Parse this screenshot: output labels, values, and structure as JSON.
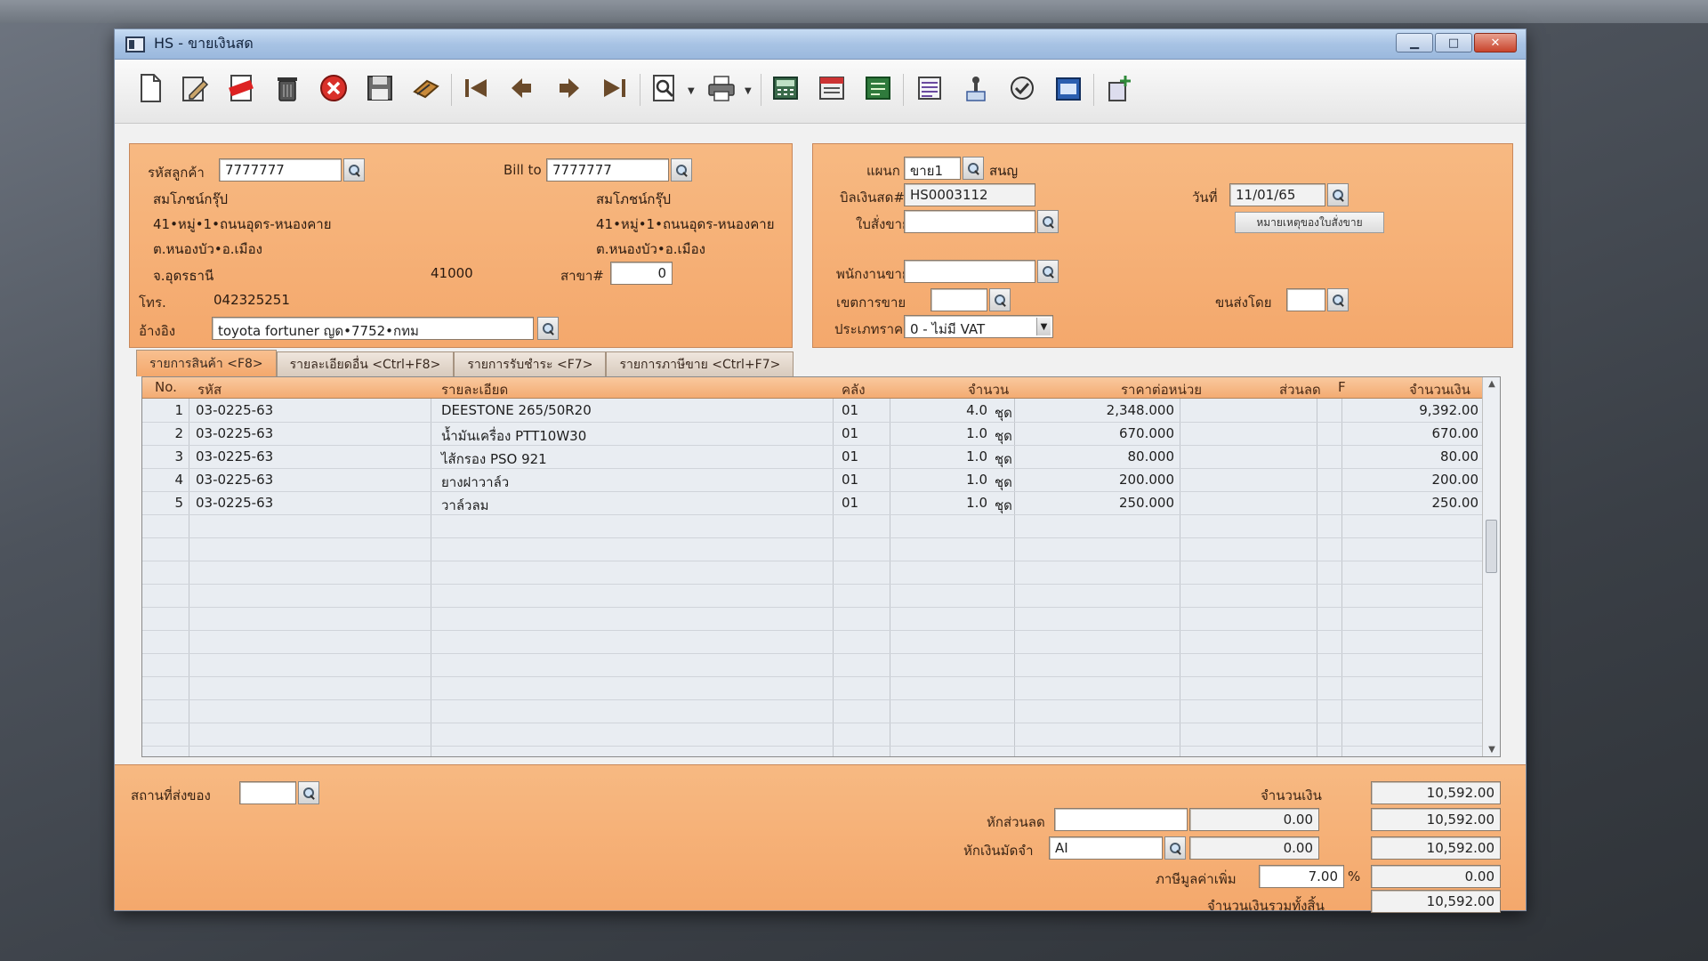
{
  "window": {
    "title": "HS - ขายเงินสด"
  },
  "titlebar_controls": {
    "minimize": "▁",
    "maximize": "□",
    "close": "✕"
  },
  "toolbar": [
    "new-icon",
    "edit-icon",
    "void-icon",
    "delete-icon",
    "cancel-icon",
    "save-icon",
    "attach-icon",
    "first-record-icon",
    "previous-record-icon",
    "next-record-icon",
    "last-record-icon",
    "preview-icon",
    "print-icon",
    "calculator-icon",
    "register-icon",
    "price-icon",
    "report-icon",
    "approve-icon",
    "confirm-icon",
    "ok-icon",
    "transfer-icon"
  ],
  "customer": {
    "code_label": "รหัสลูกค้า",
    "code": "7777777",
    "bill_to_label": "Bill to",
    "bill_to": "7777777",
    "name": "สมโภชน์กรุ๊ป",
    "address1": "41•หมู่•1•ถนนอุดร-หนองคาย",
    "address2": "ต.หนองบัว•อ.เมือง",
    "province": "จ.อุดรธานี",
    "postcode": "41000",
    "bill_name": "สมโภชน์กรุ๊ป",
    "bill_address1": "41•หมู่•1•ถนนอุดร-หนองคาย",
    "bill_address2": "ต.หนองบัว•อ.เมือง",
    "branch_label": "สาขา#",
    "branch": "0",
    "phone_label": "โทร.",
    "phone": "042325251",
    "reference_label": "อ้างอิง",
    "reference": "toyota fortuner ญด•7752•กทม"
  },
  "document": {
    "dept_label": "แผนก",
    "dept": "ขาย1",
    "dept_name": "สนญ",
    "bill_no_label": "บิลเงินสด#",
    "bill_no": "HS0003112",
    "date_label": "วันที่",
    "date": "11/01/65",
    "so_label": "ใบสั่งขาย",
    "so": "",
    "so_note_button": "หมายเหตุของใบสั่งขาย",
    "salesman_label": "พนักงานขาย",
    "salesman": "",
    "area_label": "เขตการขาย",
    "area": "",
    "ship_by_label": "ขนส่งโดย",
    "ship_by": "",
    "price_type_label": "ประเภทราคา",
    "price_type": "0 - ไม่มี VAT"
  },
  "tabs": [
    {
      "label": "รายการสินค้า <F8>",
      "active": true
    },
    {
      "label": "รายละเอียดอื่น <Ctrl+F8>",
      "active": false
    },
    {
      "label": "รายการรับชำระ <F7>",
      "active": false
    },
    {
      "label": "รายการภาษีขาย <Ctrl+F7>",
      "active": false
    }
  ],
  "grid": {
    "headers": {
      "no": "No.",
      "code": "รหัส",
      "desc": "รายละเอียด",
      "wh": "คลัง",
      "qty": "จำนวน",
      "price": "ราคาต่อหน่วย",
      "discount": "ส่วนลด",
      "f": "F",
      "amount": "จำนวนเงิน"
    },
    "rows": [
      {
        "no": "1",
        "code": "03-0225-63",
        "desc": "DEESTONE 265/50R20",
        "wh": "01",
        "qty": "4.0",
        "unit": "ชุด",
        "price": "2,348.000",
        "discount": "",
        "amount": "9,392.00"
      },
      {
        "no": "2",
        "code": "03-0225-63",
        "desc": "น้ำมันเครื่อง PTT10W30",
        "wh": "01",
        "qty": "1.0",
        "unit": "ชุด",
        "price": "670.000",
        "discount": "",
        "amount": "670.00"
      },
      {
        "no": "3",
        "code": "03-0225-63",
        "desc": "ไส้กรอง PSO 921",
        "wh": "01",
        "qty": "1.0",
        "unit": "ชุด",
        "price": "80.000",
        "discount": "",
        "amount": "80.00"
      },
      {
        "no": "4",
        "code": "03-0225-63",
        "desc": "ยางฝาวาล์ว",
        "wh": "01",
        "qty": "1.0",
        "unit": "ชุด",
        "price": "200.000",
        "discount": "",
        "amount": "200.00"
      },
      {
        "no": "5",
        "code": "03-0225-63",
        "desc": "วาล์วลม",
        "wh": "01",
        "qty": "1.0",
        "unit": "ชุด",
        "price": "250.000",
        "discount": "",
        "amount": "250.00"
      }
    ]
  },
  "footer": {
    "ship_to_label": "สถานที่ส่งของ",
    "ship_to": "",
    "amount_label": "จำนวนเงิน",
    "amount": "10,592.00",
    "discount_label": "หักส่วนลด",
    "discount_input": "",
    "discount_value": "0.00",
    "after_discount": "10,592.00",
    "deposit_label": "หักเงินมัดจำ",
    "deposit_code": "AI",
    "deposit_value": "0.00",
    "after_deposit": "10,592.00",
    "vat_label": "ภาษีมูลค่าเพิ่ม",
    "vat_rate": "7.00",
    "vat_percent_sign": "%",
    "vat_amount": "0.00",
    "total_label": "จำนวนเงินรวมทั้งสิ้น",
    "total": "10,592.00"
  },
  "colors": {
    "panel_orange": "#f4a86c",
    "header_orange": "#f3ab72",
    "titlebar_blue": "#a8c3e4",
    "close_red": "#c8442c"
  }
}
